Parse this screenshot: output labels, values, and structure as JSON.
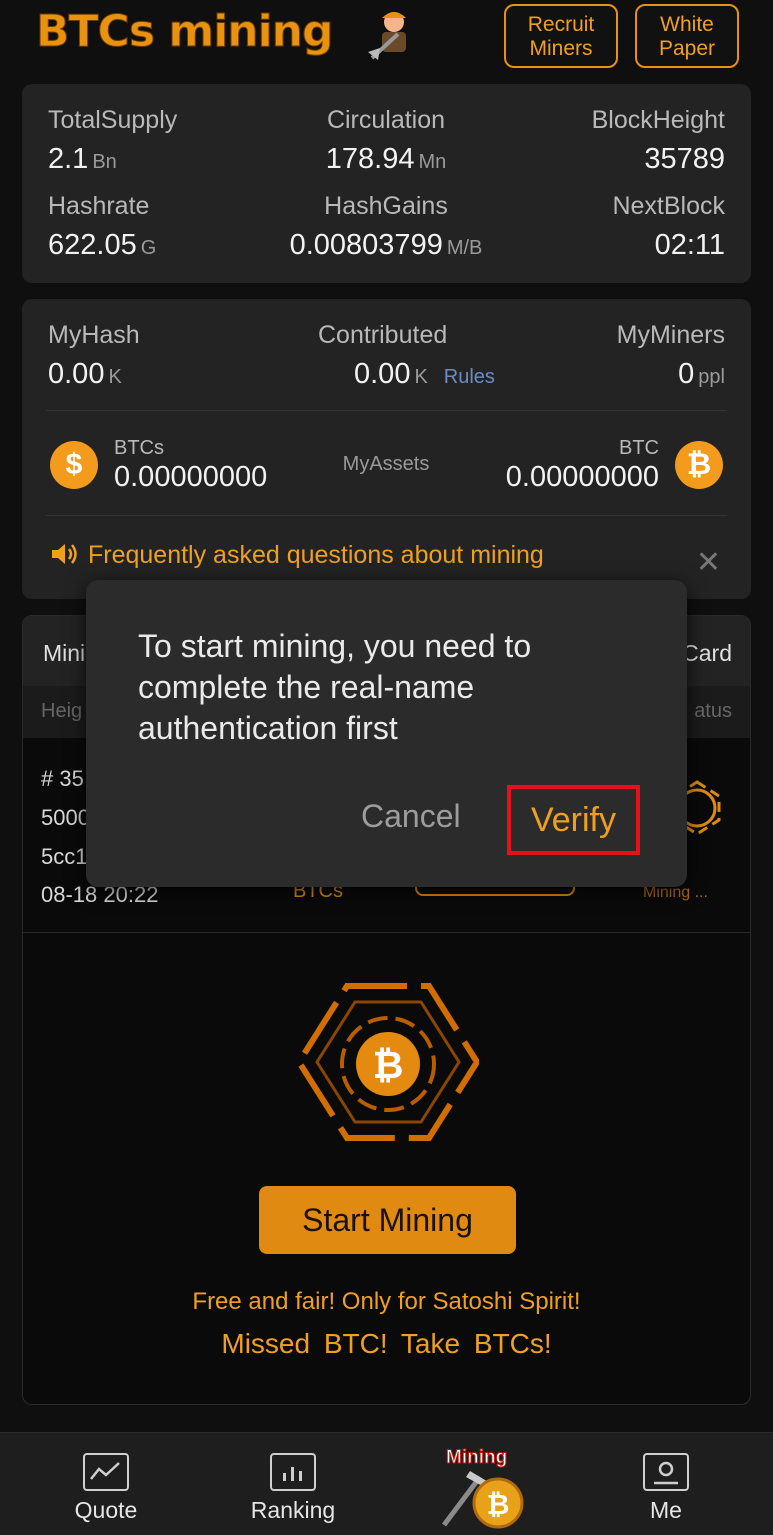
{
  "header": {
    "logo_text": "BTCs mining",
    "recruit_line1": "Recruit",
    "recruit_line2": "Miners",
    "white_line1": "White",
    "white_line2": "Paper"
  },
  "stats": {
    "total_supply": {
      "label": "TotalSupply",
      "value": "2.1",
      "unit": "Bn"
    },
    "circulation": {
      "label": "Circulation",
      "value": "178.94",
      "unit": "Mn"
    },
    "block_height": {
      "label": "BlockHeight",
      "value": "35789"
    },
    "hashrate": {
      "label": "Hashrate",
      "value": "622.05",
      "unit": "G"
    },
    "hash_gains": {
      "label": "HashGains",
      "value": "0.00803799",
      "unit": "M/B"
    },
    "next_block": {
      "label": "NextBlock",
      "value": "02:11"
    }
  },
  "my": {
    "my_hash": {
      "label": "MyHash",
      "value": "0.00",
      "unit": "K"
    },
    "contributed": {
      "label": "Contributed",
      "value": "0.00",
      "unit": "K",
      "link": "Rules"
    },
    "my_miners": {
      "label": "MyMiners",
      "value": "0",
      "unit": "ppl"
    },
    "btcs_label": "BTCs",
    "btcs_value": "0.00000000",
    "assets_label": "MyAssets",
    "btc_label": "BTC",
    "btc_value": "0.00000000",
    "btcs_coin_glyph": "$",
    "btc_coin_glyph": "₿"
  },
  "faq": {
    "text": "Frequently asked questions about mining",
    "close": "✕"
  },
  "mining_table": {
    "head_left": "Mini",
    "head_right": "Card",
    "sub_left": "Heig",
    "sub_right": "atus",
    "row": {
      "line1": "# 35",
      "line2": "5000",
      "line3": "5cc1",
      "time": "08-18 20:22",
      "coin": "BTCs",
      "status": "Mining ..."
    }
  },
  "start_button": "Start Mining",
  "slogan_1": "Free and fair! Only for Satoshi Spirit!",
  "slogan_2": "Missed BTC!   Take BTCs!",
  "modal": {
    "message": "To start mining, you need to complete the real-name authentication first",
    "cancel": "Cancel",
    "verify": "Verify"
  },
  "tabs": {
    "quote": "Quote",
    "ranking": "Ranking",
    "mining": "Mining",
    "me": "Me"
  },
  "colors": {
    "accent": "#f0a020",
    "highlight": "#e8111a"
  }
}
